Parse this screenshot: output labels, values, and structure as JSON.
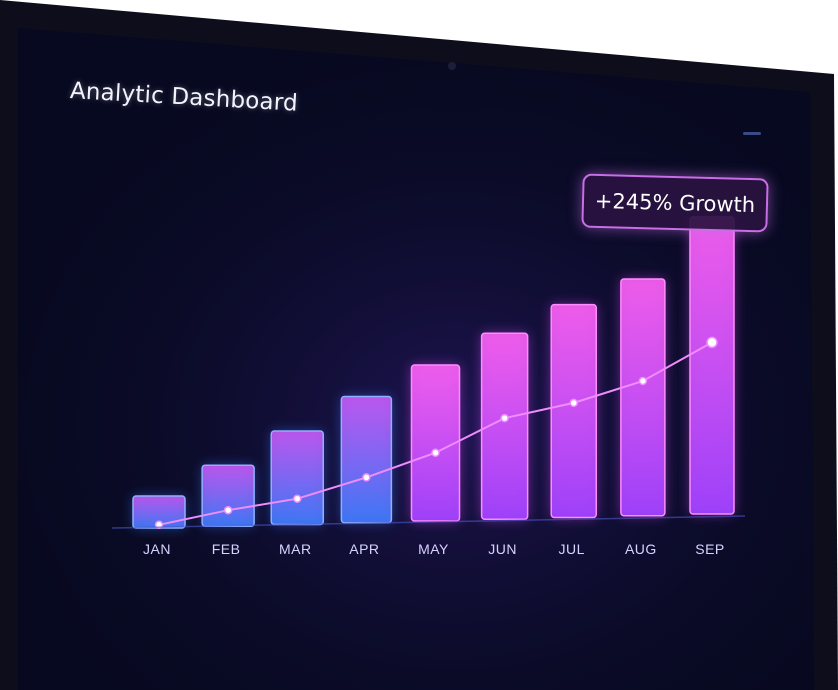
{
  "dashboard": {
    "title": "Analytic Dashboard",
    "badge": "+245% Growth"
  },
  "colors": {
    "screen": "#070920",
    "bezel": "#111126",
    "bar_blue": "#3a7bff",
    "bar_pink": "#e24bff",
    "line": "#f08cff"
  },
  "chart_data": {
    "type": "bar",
    "categories": [
      "JAN",
      "FEB",
      "MAR",
      "APR",
      "MAY",
      "JUN",
      "JUL",
      "AUG",
      "SEP"
    ],
    "series": [
      {
        "values": [
          10,
          19,
          29,
          39,
          48,
          57,
          65,
          72,
          90
        ]
      },
      {
        "type": "line",
        "values": [
          1,
          5,
          8,
          14,
          21,
          31,
          35,
          41,
          52
        ]
      }
    ],
    "title": "Analytic Dashboard",
    "annotations": [
      "+245% Growth"
    ],
    "xlabel": "",
    "ylabel": "",
    "ylim": [
      0,
      100
    ],
    "grid": false
  }
}
